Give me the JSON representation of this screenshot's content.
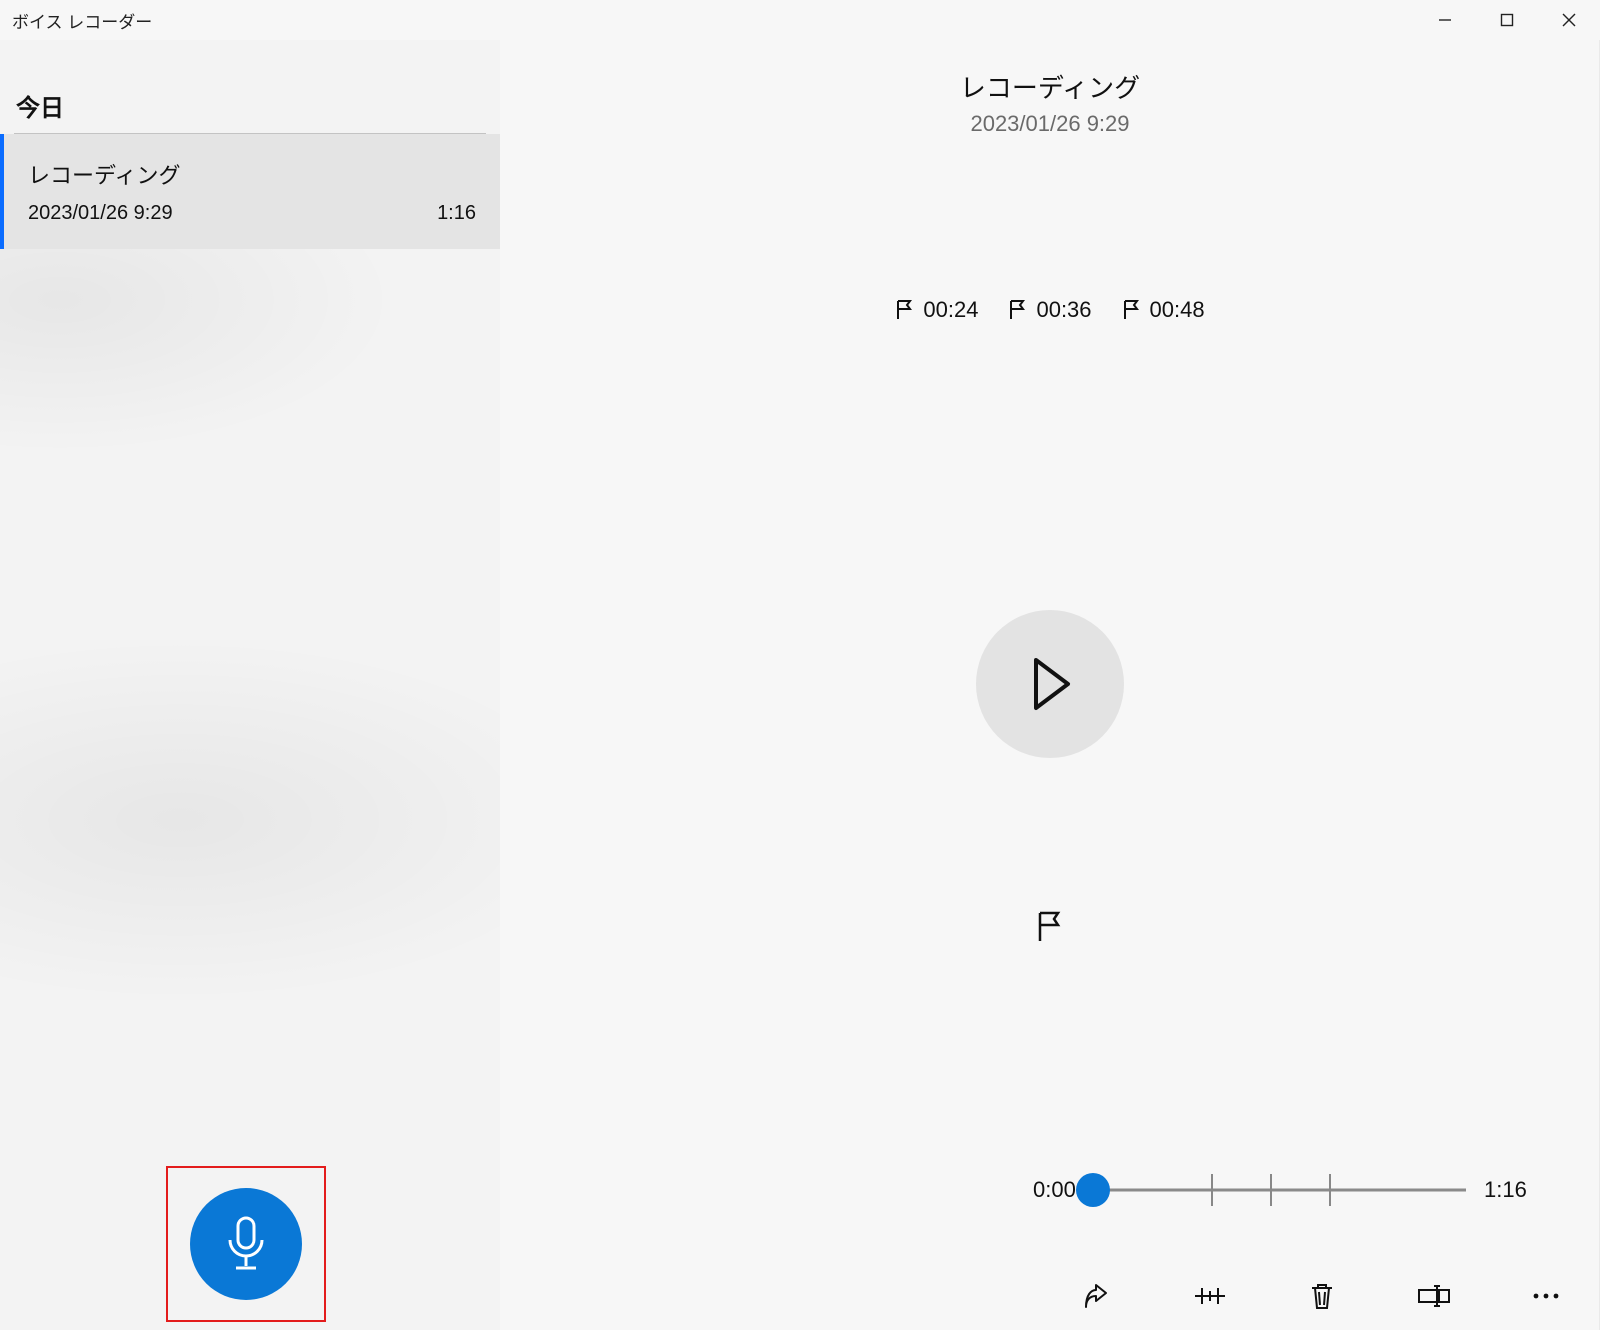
{
  "app": {
    "title": "ボイス レコーダー"
  },
  "sidebar": {
    "section_label": "今日",
    "items": [
      {
        "name": "レコーディング",
        "date": "2023/01/26 9:29",
        "duration": "1:16"
      }
    ]
  },
  "record_button": {
    "icon": "microphone-icon"
  },
  "detail": {
    "name": "レコーディング",
    "date": "2023/01/26 9:29",
    "markers": [
      {
        "time": "00:24"
      },
      {
        "time": "00:36"
      },
      {
        "time": "00:48"
      }
    ],
    "timeline": {
      "start": "0:00",
      "end": "1:16",
      "position_pct": 0,
      "ticks_pct": [
        31.6,
        47.4,
        63.2
      ]
    }
  },
  "action_icons": [
    "share-icon",
    "trim-icon",
    "delete-icon",
    "rename-icon",
    "more-icon"
  ],
  "colors": {
    "accent": "#0a78d6",
    "highlight_border": "#e31b1b"
  }
}
